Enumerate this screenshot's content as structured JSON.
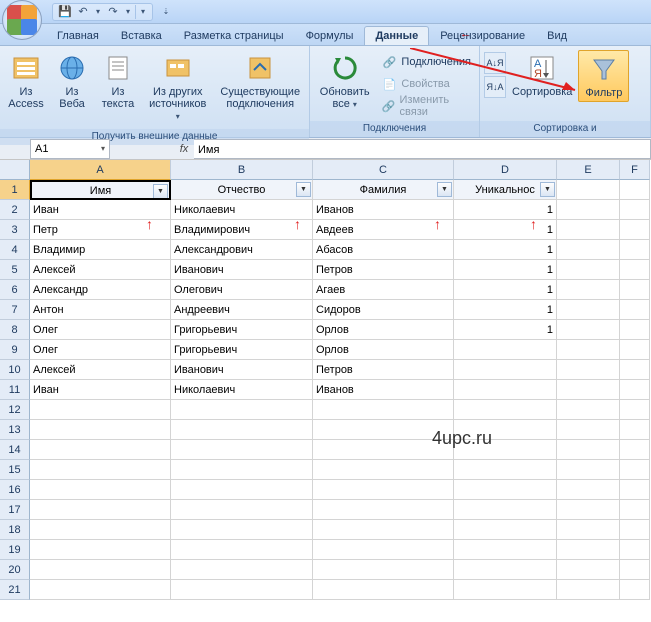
{
  "qat": {
    "save": "💾",
    "undo": "↶",
    "redo": "↷"
  },
  "tabs": {
    "home": "Главная",
    "insert": "Вставка",
    "pagelayout": "Разметка страницы",
    "formulas": "Формулы",
    "data": "Данные",
    "review": "Рецензирование",
    "view": "Вид"
  },
  "ribbon": {
    "get_ext": {
      "access": "Из Access",
      "web": "Из Веба",
      "text": "Из текста",
      "other": "Из других источников",
      "existing": "Существующие подключения",
      "group": "Получить внешние данные"
    },
    "conn": {
      "refresh": "Обновить все",
      "connections": "Подключения",
      "properties": "Свойства",
      "editlinks": "Изменить связи",
      "group": "Подключения"
    },
    "sort": {
      "az": "А↓Я",
      "za": "Я↓А",
      "sort": "Сортировка",
      "filter": "Фильтр",
      "group": "Сортировка и"
    }
  },
  "namebox": "A1",
  "formula": "Имя",
  "headers": {
    "A": "Имя",
    "B": "Отчество",
    "C": "Фамилия",
    "D": "Уникальнос"
  },
  "cols": [
    "A",
    "B",
    "C",
    "D",
    "E",
    "F"
  ],
  "rows": [
    {
      "n": "2",
      "A": "Иван",
      "B": "Николаевич",
      "C": "Иванов",
      "D": "1"
    },
    {
      "n": "3",
      "A": "Петр",
      "B": "Владимирович",
      "C": "Авдеев",
      "D": "1"
    },
    {
      "n": "4",
      "A": "Владимир",
      "B": "Александрович",
      "C": "Абасов",
      "D": "1"
    },
    {
      "n": "5",
      "A": "Алексей",
      "B": "Иванович",
      "C": "Петров",
      "D": "1"
    },
    {
      "n": "6",
      "A": "Александр",
      "B": "Олегович",
      "C": "Агаев",
      "D": "1"
    },
    {
      "n": "7",
      "A": "Антон",
      "B": "Андреевич",
      "C": "Сидоров",
      "D": "1"
    },
    {
      "n": "8",
      "A": "Олег",
      "B": "Григорьевич",
      "C": "Орлов",
      "D": "1"
    },
    {
      "n": "9",
      "A": "Олег",
      "B": "Григорьевич",
      "C": "Орлов",
      "D": ""
    },
    {
      "n": "10",
      "A": "Алексей",
      "B": "Иванович",
      "C": "Петров",
      "D": ""
    },
    {
      "n": "11",
      "A": "Иван",
      "B": "Николаевич",
      "C": "Иванов",
      "D": ""
    }
  ],
  "empty_rows": [
    "12",
    "13",
    "14",
    "15",
    "16",
    "17",
    "18",
    "19",
    "20",
    "21"
  ],
  "watermark": "4upc.ru"
}
